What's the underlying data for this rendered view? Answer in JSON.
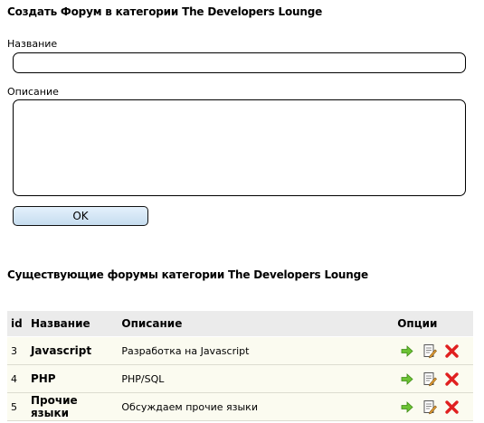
{
  "create_form": {
    "title": "Создать Форум в категории The Developers Lounge",
    "name_label": "Название",
    "name_value": "",
    "description_label": "Описание",
    "description_value": "",
    "ok_label": "OK"
  },
  "existing": {
    "title": "Существующие форумы категории The Developers Lounge",
    "columns": {
      "id": "id",
      "name": "Название",
      "description": "Описание",
      "options": "Опции"
    },
    "rows": [
      {
        "id": "3",
        "name": "Javascript",
        "description": "Разработка на Javascript"
      },
      {
        "id": "4",
        "name": "PHP",
        "description": "PHP/SQL"
      },
      {
        "id": "5",
        "name": "Прочие языки",
        "description": "Обсуждаем прочие языки"
      }
    ],
    "row_icons": [
      "arrow-right-icon",
      "edit-icon",
      "delete-icon"
    ]
  },
  "colors": {
    "header_bg": "#ebebeb",
    "row_bg": "#fbfbf0",
    "button_bg": "#d4e6f5",
    "arrow": "#6cc234",
    "delete": "#e02020"
  }
}
